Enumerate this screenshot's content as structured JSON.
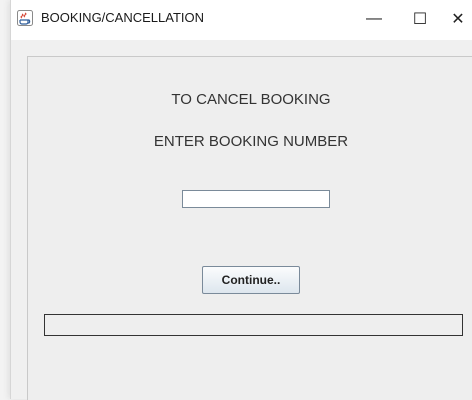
{
  "window": {
    "title": "BOOKING/CANCELLATION",
    "controls": {
      "minimize": "—",
      "maximize": "☐",
      "close": "✕"
    }
  },
  "form": {
    "heading_line1": "TO CANCEL BOOKING",
    "heading_line2": "ENTER BOOKING NUMBER",
    "booking_number_value": "",
    "continue_label": "Continue..",
    "status_text": ""
  }
}
